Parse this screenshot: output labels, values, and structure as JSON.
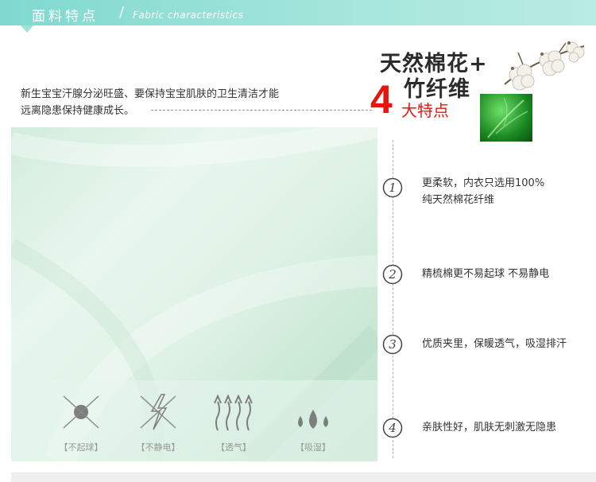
{
  "banner": {
    "title": "面料特点",
    "separator": "/",
    "subtitle": "Fabric characteristics"
  },
  "intro": {
    "line1": "新生宝宝汗腺分泌旺盛、要保持宝宝肌肤的卫生清洁才能",
    "line2": "远离隐患保持健康成长。"
  },
  "headline": {
    "line1": "天然棉花+",
    "line2": "竹纤维",
    "big_number": "4",
    "number_text": "大特点"
  },
  "fabric_icons": [
    {
      "name": "pilling-icon",
      "label": "【不起球】"
    },
    {
      "name": "static-icon",
      "label": "【不静电】"
    },
    {
      "name": "breathable-icon",
      "label": "【透气】"
    },
    {
      "name": "moisture-icon",
      "label": "【吸湿】"
    }
  ],
  "features": [
    {
      "number": "1",
      "line1": "更柔软，内衣只选用100%",
      "line2": "纯天然棉花纤维"
    },
    {
      "number": "2",
      "line1": "精梳棉更不易起球 不易静电",
      "line2": ""
    },
    {
      "number": "3",
      "line1": "优质夹里，保暖透气，吸湿排汗",
      "line2": ""
    },
    {
      "number": "4",
      "line1": "亲肤性好，肌肤无刺激无隐患",
      "line2": ""
    }
  ],
  "colors": {
    "banner": "#7fd9cf",
    "accent_red": "#e4170f",
    "fabric": "#dff2e6"
  }
}
